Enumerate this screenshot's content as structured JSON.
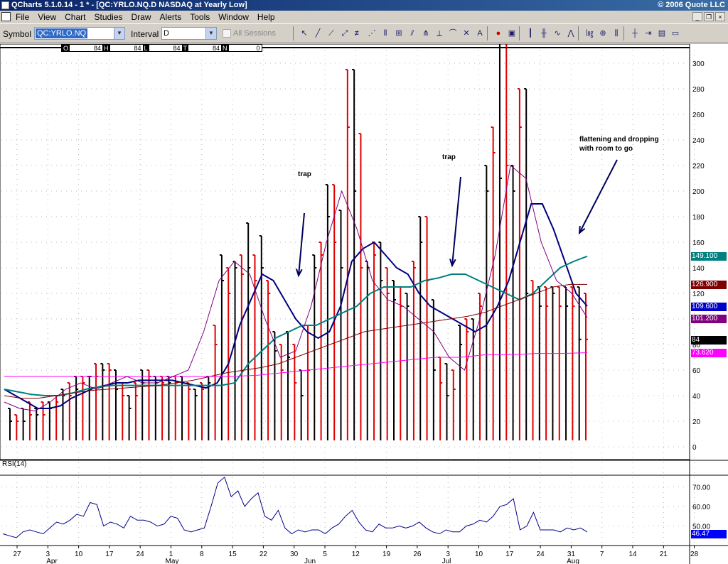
{
  "window": {
    "title": "QCharts 5.1.0.14 - 1 * - [QC:YRLO.NQ.D NASDAQ at Yearly Low]",
    "copyright": "© 2006 Quote LLC"
  },
  "menu": [
    "File",
    "View",
    "Chart",
    "Studies",
    "Draw",
    "Alerts",
    "Tools",
    "Window",
    "Help"
  ],
  "toolbar": {
    "symbol_label": "Symbol",
    "symbol_value": "QC:YRLO.NQ",
    "interval_label": "Interval",
    "interval_value": "D",
    "all_sessions_label": "All Sessions"
  },
  "ohlc": [
    {
      "key": "O",
      "value": "84"
    },
    {
      "key": "H",
      "value": "84"
    },
    {
      "key": "L",
      "value": "84"
    },
    {
      "key": "T",
      "value": "84"
    },
    {
      "key": "N",
      "value": "0"
    }
  ],
  "price_tags": [
    {
      "label": "149.100",
      "color": "#008080",
      "text_color": "#ffffff"
    },
    {
      "label": "126.900",
      "color": "#800000",
      "text_color": "#ffffff"
    },
    {
      "label": "109.600",
      "color": "#0000cc",
      "text_color": "#ffffff"
    },
    {
      "label": "101.200",
      "color": "#800080",
      "text_color": "#ffffff"
    },
    {
      "label": "84",
      "color": "#000000",
      "text_color": "#ffffff"
    },
    {
      "label": "73.620",
      "color": "#ff00ff",
      "text_color": "#ffffff"
    },
    {
      "label": "46.47",
      "color": "#0000ff",
      "text_color": "#ffffff"
    }
  ],
  "annotations": {
    "trap1": "trap",
    "trap2": "trap",
    "flat_line1": "flattening and dropping",
    "flat_line2": "with room to go"
  },
  "rsi_label": "RSI(14)",
  "chart_data": [
    {
      "type": "bar",
      "title": "QC:YRLO.NQ.D NASDAQ at Yearly Low",
      "y_ticks": [
        0,
        20,
        40,
        60,
        80,
        100,
        120,
        140,
        160,
        180,
        200,
        220,
        240,
        260,
        280,
        300
      ],
      "ylim": [
        -5,
        320
      ],
      "x_tick_labels": [
        "27",
        "3",
        "10",
        "17",
        "24",
        "1",
        "8",
        "15",
        "22",
        "30",
        "5",
        "12",
        "19",
        "26",
        "3",
        "10",
        "17",
        "24",
        "31",
        "7",
        "14",
        "21",
        "28"
      ],
      "month_labels": [
        "Apr",
        "May",
        "Jun",
        "Jul",
        "Aug"
      ],
      "bars_high": [
        30,
        25,
        30,
        35,
        30,
        35,
        35,
        40,
        45,
        50,
        55,
        55,
        55,
        65,
        65,
        65,
        60,
        50,
        40,
        50,
        60,
        60,
        55,
        55,
        55,
        55,
        55,
        50,
        45,
        50,
        55,
        95,
        150,
        140,
        145,
        150,
        175,
        150,
        165,
        130,
        90,
        80,
        90,
        80,
        60,
        95,
        150,
        160,
        205,
        205,
        185,
        295,
        295,
        245,
        145,
        160,
        160,
        140,
        130,
        125,
        120,
        145,
        180,
        180,
        115,
        70,
        65,
        60,
        95,
        100,
        100,
        120,
        220,
        250,
        330,
        330,
        220,
        280,
        280,
        130,
        125,
        125,
        125,
        125,
        125,
        125,
        125,
        120
      ],
      "bars_low": [
        5,
        5,
        5,
        5,
        5,
        5,
        5,
        5,
        5,
        5,
        5,
        5,
        5,
        5,
        5,
        5,
        5,
        5,
        5,
        5,
        5,
        5,
        5,
        5,
        5,
        5,
        5,
        5,
        5,
        5,
        5,
        5,
        5,
        5,
        5,
        5,
        5,
        5,
        5,
        5,
        5,
        5,
        5,
        5,
        5,
        5,
        5,
        5,
        5,
        5,
        5,
        5,
        5,
        5,
        5,
        5,
        5,
        5,
        5,
        5,
        5,
        5,
        5,
        5,
        5,
        5,
        5,
        5,
        5,
        5,
        5,
        5,
        5,
        5,
        5,
        5,
        5,
        5,
        5,
        5,
        5,
        5,
        5,
        5,
        5,
        5,
        5,
        5
      ],
      "bars_close": [
        20,
        20,
        20,
        25,
        25,
        25,
        30,
        35,
        40,
        40,
        45,
        50,
        55,
        55,
        60,
        60,
        45,
        40,
        30,
        40,
        50,
        55,
        50,
        50,
        50,
        50,
        50,
        45,
        40,
        45,
        50,
        80,
        130,
        120,
        140,
        135,
        140,
        130,
        140,
        120,
        75,
        60,
        70,
        50,
        40,
        60,
        140,
        150,
        180,
        160,
        140,
        250,
        200,
        140,
        140,
        150,
        130,
        120,
        115,
        110,
        110,
        140,
        160,
        130,
        60,
        50,
        40,
        45,
        80,
        90,
        90,
        110,
        200,
        230,
        210,
        220,
        200,
        250,
        120,
        120,
        110,
        110,
        120,
        110,
        110,
        110,
        84,
        84
      ],
      "series": [
        {
          "name": "",
          "color": "#000080",
          "values": [
            45,
            40,
            35,
            30,
            30,
            32,
            38,
            42,
            46,
            48,
            50,
            50,
            52,
            52,
            52,
            52,
            50,
            48,
            46,
            50,
            65,
            95,
            115,
            135,
            130,
            115,
            100,
            90,
            85,
            90,
            110,
            145,
            155,
            160,
            150,
            140,
            135,
            120,
            110,
            105,
            100,
            95,
            90,
            95,
            110,
            130,
            160,
            190,
            190,
            170,
            145,
            120,
            110
          ]
        },
        {
          "name": "",
          "color": "#008080",
          "values": [
            45,
            43,
            41,
            40,
            40,
            42,
            45,
            47,
            48,
            48,
            48,
            48,
            48,
            48,
            48,
            48,
            48,
            50,
            65,
            75,
            85,
            90,
            95,
            95,
            100,
            105,
            110,
            120,
            125,
            125,
            125,
            130,
            132,
            135,
            135,
            130,
            125,
            120,
            115,
            120,
            130,
            140,
            145,
            149
          ]
        },
        {
          "name": "",
          "color": "#800000",
          "values": [
            40,
            38,
            38,
            40,
            42,
            44,
            45,
            46,
            47,
            48,
            50,
            52,
            55,
            58,
            60,
            62,
            65,
            70,
            75,
            80,
            85,
            90,
            92,
            94,
            96,
            98,
            100,
            102,
            105,
            110,
            115,
            120,
            125,
            127,
            127
          ]
        },
        {
          "name": "",
          "color": "#ff00ff",
          "values": [
            55,
            55,
            55,
            55,
            55,
            55,
            55,
            55,
            55,
            55,
            56,
            58,
            60,
            62,
            64,
            66,
            68,
            70,
            70,
            72,
            72,
            73,
            73,
            73.6
          ]
        },
        {
          "name": "",
          "color": "#800080",
          "values": [
            35,
            30,
            28,
            35,
            45,
            50,
            45,
            50,
            55,
            50,
            50,
            55,
            60,
            90,
            130,
            145,
            135,
            100,
            70,
            75,
            110,
            160,
            200,
            170,
            130,
            115,
            110,
            100,
            90,
            70,
            60,
            100,
            150,
            220,
            210,
            160,
            130,
            120,
            101
          ]
        }
      ]
    },
    {
      "type": "line",
      "title": "RSI(14)",
      "y_ticks": [
        50,
        60,
        70
      ],
      "ylim": [
        40,
        76
      ],
      "series": [
        {
          "name": "RSI(14)",
          "color": "#00008b",
          "values": [
            46,
            45,
            44,
            47,
            48,
            47,
            46,
            49,
            52,
            51,
            53,
            56,
            55,
            62,
            61,
            50,
            52,
            51,
            49,
            55,
            53,
            53,
            52,
            50,
            51,
            55,
            54,
            48,
            47,
            48,
            49,
            60,
            72,
            75,
            65,
            68,
            60,
            64,
            67,
            55,
            53,
            58,
            49,
            46,
            48,
            47,
            48,
            48,
            46,
            49,
            51,
            55,
            58,
            52,
            48,
            47,
            51,
            49,
            49,
            50,
            49,
            50,
            52,
            49,
            47,
            46,
            48,
            47,
            47,
            50,
            51,
            53,
            52,
            55,
            60,
            61,
            64,
            48,
            50,
            57,
            48,
            48,
            48,
            47,
            49,
            48,
            49,
            47
          ]
        }
      ]
    }
  ]
}
